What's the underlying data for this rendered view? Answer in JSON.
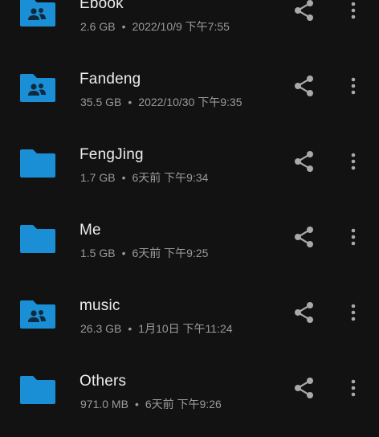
{
  "colors": {
    "background": "#121212",
    "folder": "#1a8fd6",
    "folder_symbol": "#0f2a3d",
    "title": "#ececec",
    "meta": "#9a9a9a",
    "icon": "#a9a9a9"
  },
  "folders": [
    {
      "name": "Ebook",
      "size": "2.6 GB",
      "separator": "•",
      "date": "2022/10/9 下午7:55",
      "icon": "shared-folder-icon"
    },
    {
      "name": "Fandeng",
      "size": "35.5 GB",
      "separator": "•",
      "date": "2022/10/30 下午9:35",
      "icon": "shared-folder-icon"
    },
    {
      "name": "FengJing",
      "size": "1.7 GB",
      "separator": "•",
      "date": "6天前 下午9:34",
      "icon": "folder-icon"
    },
    {
      "name": "Me",
      "size": "1.5 GB",
      "separator": "•",
      "date": "6天前 下午9:25",
      "icon": "folder-icon"
    },
    {
      "name": "music",
      "size": "26.3 GB",
      "separator": "•",
      "date": "1月10日 下午11:24",
      "icon": "shared-folder-icon"
    },
    {
      "name": "Others",
      "size": "971.0 MB",
      "separator": "•",
      "date": "6天前 下午9:26",
      "icon": "folder-icon"
    }
  ]
}
